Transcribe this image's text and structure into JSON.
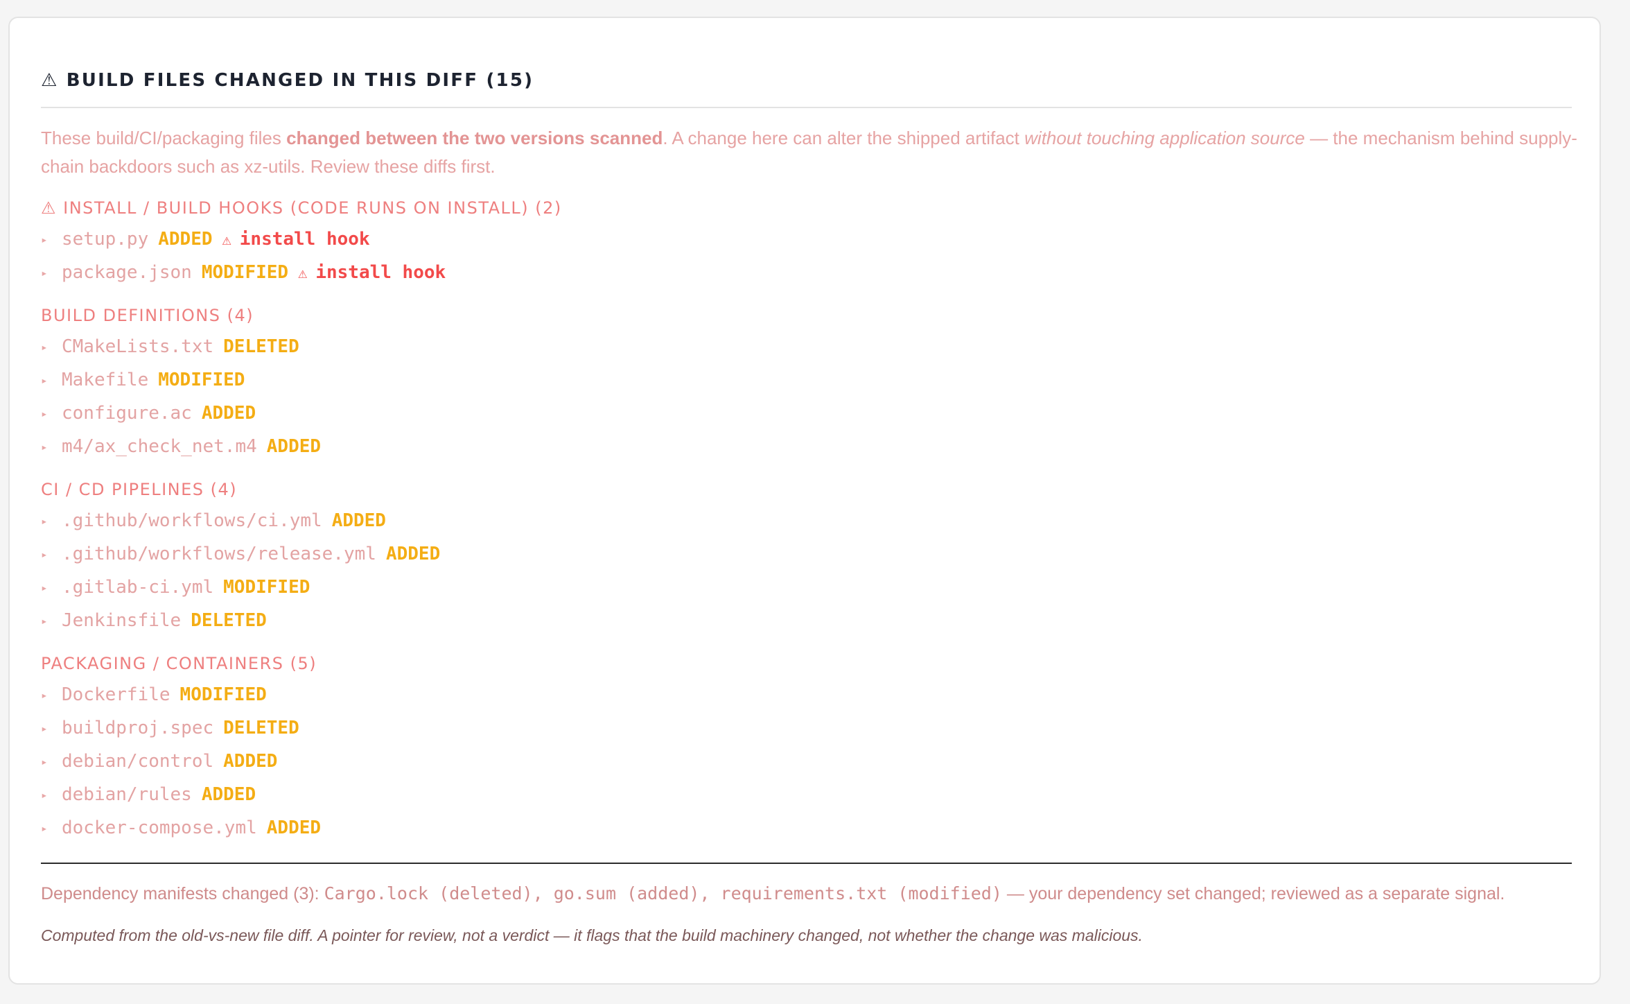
{
  "panel": {
    "title_icon": "⚠",
    "title": "BUILD FILES CHANGED IN THIS DIFF (15)",
    "intro": {
      "p1": "These build/CI/packaging files ",
      "p2_bold": "changed between the two versions scanned",
      "p3": ". A change here can alter the shipped artifact ",
      "p4_italic": "without touching application source",
      "p5": " — the mechanism behind supply-chain backdoors such as xz-utils. Review these diffs first."
    },
    "sections": [
      {
        "heading": "⚠ INSTALL / BUILD HOOKS (CODE RUNS ON INSTALL) (2)",
        "files": [
          {
            "name": "setup.py",
            "status": "ADDED",
            "hook": "install hook"
          },
          {
            "name": "package.json",
            "status": "MODIFIED",
            "hook": "install hook"
          }
        ]
      },
      {
        "heading": "BUILD DEFINITIONS (4)",
        "files": [
          {
            "name": "CMakeLists.txt",
            "status": "DELETED"
          },
          {
            "name": "Makefile",
            "status": "MODIFIED"
          },
          {
            "name": "configure.ac",
            "status": "ADDED"
          },
          {
            "name": "m4/ax_check_net.m4",
            "status": "ADDED"
          }
        ]
      },
      {
        "heading": "CI / CD PIPELINES (4)",
        "files": [
          {
            "name": ".github/workflows/ci.yml",
            "status": "ADDED"
          },
          {
            "name": ".github/workflows/release.yml",
            "status": "ADDED"
          },
          {
            "name": ".gitlab-ci.yml",
            "status": "MODIFIED"
          },
          {
            "name": "Jenkinsfile",
            "status": "DELETED"
          }
        ]
      },
      {
        "heading": "PACKAGING / CONTAINERS (5)",
        "files": [
          {
            "name": "Dockerfile",
            "status": "MODIFIED"
          },
          {
            "name": "buildproj.spec",
            "status": "DELETED"
          },
          {
            "name": "debian/control",
            "status": "ADDED"
          },
          {
            "name": "debian/rules",
            "status": "ADDED"
          },
          {
            "name": "docker-compose.yml",
            "status": "ADDED"
          }
        ]
      }
    ],
    "caret_glyph": "▸",
    "hook_glyph": "⚠",
    "dependencies": {
      "prefix": "Dependency manifests changed (3): ",
      "items": "Cargo.lock (deleted), go.sum (added), requirements.txt (modified)",
      "suffix": " — your dependency set changed; reviewed as a separate signal."
    },
    "footnote": "Computed from the old-vs-new file diff. A pointer for review, not a verdict — it flags that the build machinery changed, not whether the change was malicious."
  },
  "colors": {
    "title": "#1d2330",
    "section_heading": "#ee7f7f",
    "status": "#f4ad14",
    "hook": "#f24a4a",
    "filename": "#e3a3a3"
  }
}
